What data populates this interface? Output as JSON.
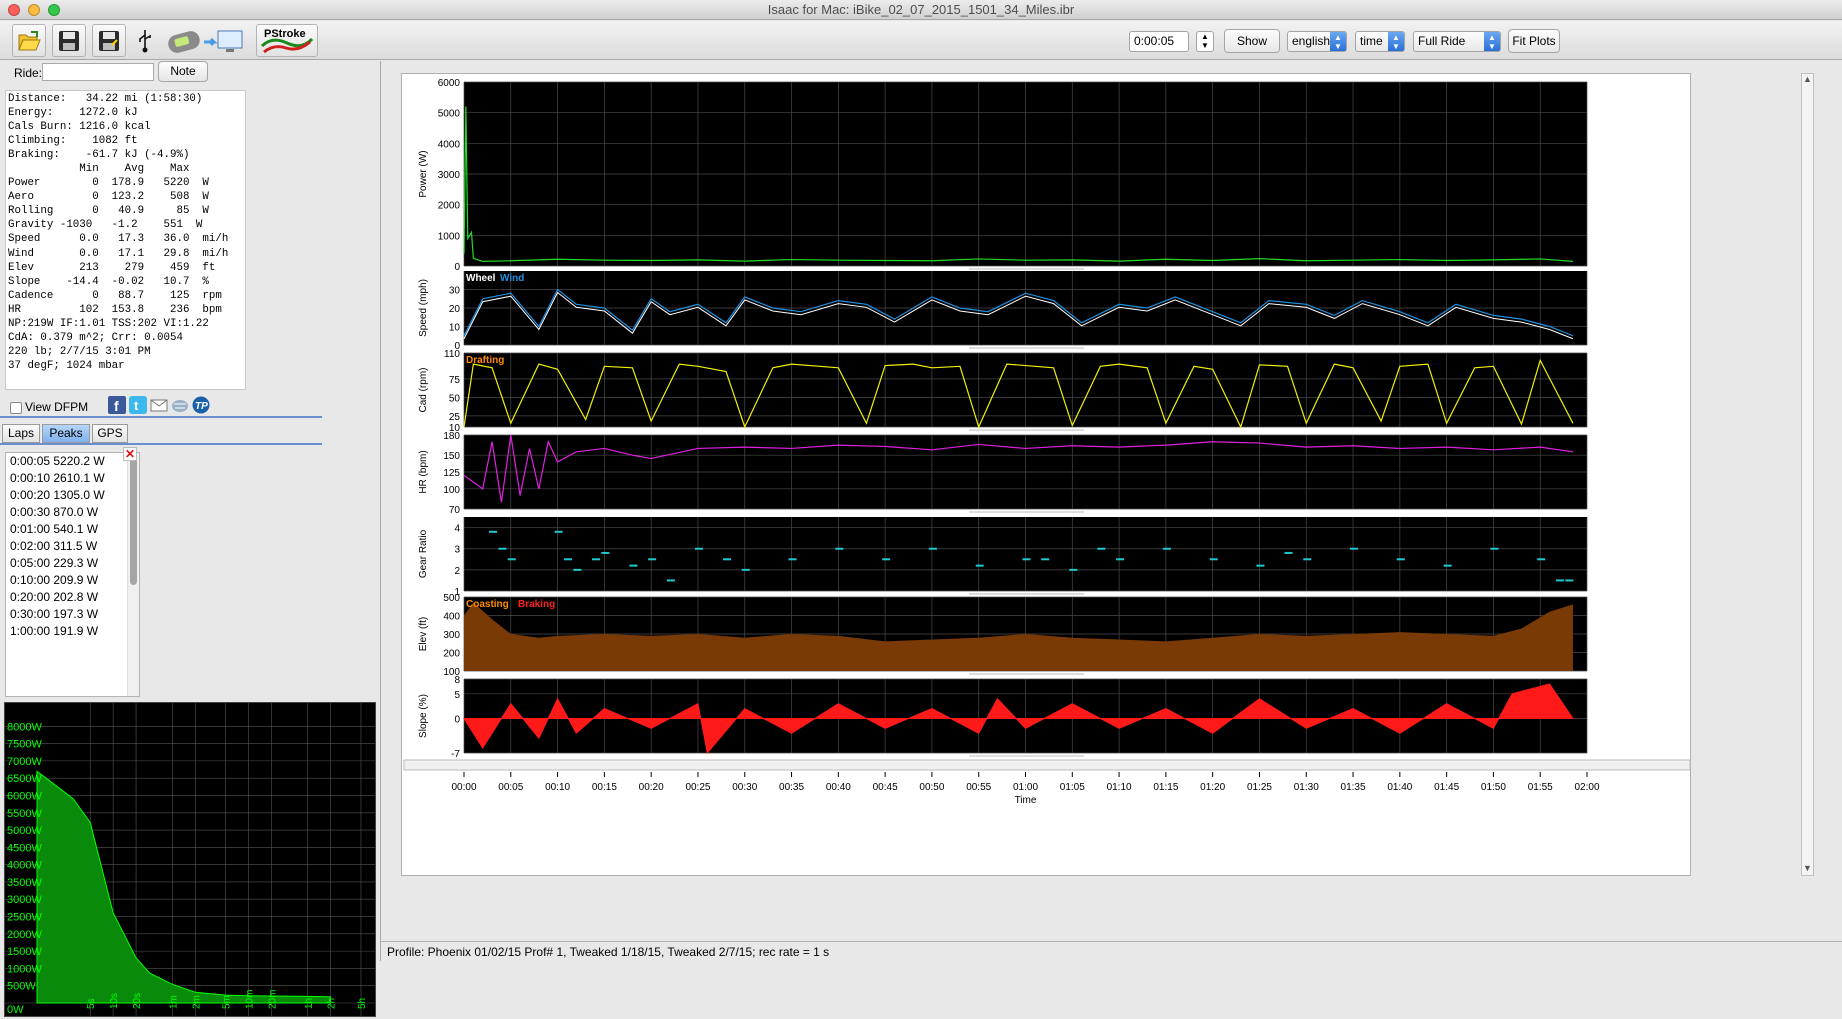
{
  "window": {
    "title": "Isaac for Mac:  iBike_02_07_2015_1501_34_Miles.ibr"
  },
  "toolbar": {
    "open_icon": "folder-open-icon",
    "save_icon": "floppy-save-icon",
    "saveas_icon": "floppy-save-as-icon",
    "usb_icon": "usb-icon",
    "sync_icon": "device-to-computer-icon",
    "pstroke_label": "PStroke",
    "time_value": "0:00:05",
    "show_label": "Show",
    "units": "english",
    "xaxis": "time",
    "range": "Full Ride",
    "fit_label": "Fit Plots"
  },
  "ride": {
    "label": "Ride:",
    "value": "",
    "note_label": "Note"
  },
  "summary": {
    "lines": [
      "Distance:   34.22 mi (1:58:30)",
      "Energy:    1272.0 kJ",
      "Cals Burn: 1216.0 kcal",
      "Climbing:    1082 ft",
      "Braking:    -61.7 kJ (-4.9%)",
      "           Min    Avg    Max",
      "Power        0  178.9   5220  W",
      "Aero         0  123.2    508  W",
      "Rolling      0   40.9     85  W",
      "Gravity -1030   -1.2    551  W",
      "Speed      0.0   17.3   36.0  mi/h",
      "Wind       0.0   17.1   29.8  mi/h",
      "Elev       213    279    459  ft",
      "Slope    -14.4  -0.02   10.7  %",
      "Cadence      0   88.7    125  rpm",
      "HR         102  153.8    236  bpm",
      "NP:219W IF:1.01 TSS:202 VI:1.22",
      "CdA: 0.379 m^2; Crr: 0.0054",
      "220 lb; 2/7/15 3:01 PM",
      "37 degF; 1024 mbar"
    ]
  },
  "dfpm": {
    "label": "View DFPM",
    "checked": false
  },
  "share_icons": [
    "facebook-icon",
    "twitter-icon",
    "email-icon",
    "cloud-upload-icon",
    "trainingpeaks-icon"
  ],
  "tabs": [
    {
      "label": "Laps",
      "active": false
    },
    {
      "label": "Peaks",
      "active": true
    },
    {
      "label": "GPS",
      "active": false
    }
  ],
  "peaks": [
    {
      "dur": "0:00:05",
      "val": "5220.2 W"
    },
    {
      "dur": "0:00:10",
      "val": "2610.1 W"
    },
    {
      "dur": "0:00:20",
      "val": "1305.0 W"
    },
    {
      "dur": "0:00:30",
      "val": "870.0 W"
    },
    {
      "dur": "0:01:00",
      "val": "540.1 W"
    },
    {
      "dur": "0:02:00",
      "val": "311.5 W"
    },
    {
      "dur": "0:05:00",
      "val": "229.3 W"
    },
    {
      "dur": "0:10:00",
      "val": "209.9 W"
    },
    {
      "dur": "0:20:00",
      "val": "202.8 W"
    },
    {
      "dur": "0:30:00",
      "val": "197.3 W"
    },
    {
      "dur": "1:00:00",
      "val": "191.9 W"
    }
  ],
  "chart_data": [
    {
      "type": "area",
      "name": "peak-power-curve",
      "y_ticks": [
        "0W",
        "500W",
        "1000W",
        "1500W",
        "2000W",
        "2500W",
        "3000W",
        "3500W",
        "4000W",
        "4500W",
        "5000W",
        "5500W",
        "6000W",
        "6500W",
        "7000W",
        "7500W",
        "8000W"
      ],
      "x_ticks": [
        "5s",
        "10s",
        "20s",
        "1m",
        "2m",
        "5m",
        "10m",
        "20m",
        "1h",
        "2h",
        "5h"
      ],
      "points_sec": [
        1,
        2,
        3,
        5,
        10,
        20,
        30,
        60,
        120,
        300,
        600,
        1200,
        1800,
        3600,
        7110
      ],
      "points_w": [
        6700,
        6200,
        5900,
        5220,
        2610,
        1305,
        870,
        540,
        311,
        229,
        210,
        203,
        197,
        192,
        180
      ],
      "ylim": [
        0,
        8500
      ],
      "color": "#00ff00"
    },
    {
      "type": "line",
      "name": "power",
      "ylabel": "Power (W)",
      "yticks": [
        "0",
        "1000",
        "2000",
        "3000",
        "4000",
        "5000",
        "6000"
      ],
      "ylim": [
        0,
        6000
      ],
      "color": "#22dd22",
      "x_min": [
        0,
        0.2,
        0.4,
        0.8,
        1,
        2,
        5,
        10,
        15,
        20,
        25,
        30,
        35,
        40,
        45,
        50,
        55,
        60,
        65,
        70,
        75,
        80,
        85,
        90,
        95,
        100,
        105,
        110,
        115,
        118.5
      ],
      "y": [
        400,
        5200,
        900,
        1100,
        250,
        150,
        170,
        220,
        190,
        180,
        200,
        160,
        210,
        190,
        180,
        170,
        230,
        190,
        200,
        160,
        220,
        180,
        240,
        170,
        190,
        210,
        180,
        200,
        230,
        150
      ]
    },
    {
      "type": "line",
      "name": "speed",
      "ylabel": "Speed (mph)",
      "legend": [
        "Wheel",
        "Wind"
      ],
      "yticks": [
        "0",
        "10",
        "20",
        "30"
      ],
      "ylim": [
        0,
        40
      ],
      "colors": [
        "#ffffff",
        "#1e90e0"
      ],
      "x_min": [
        0,
        2,
        5,
        8,
        10,
        12,
        15,
        18,
        20,
        22,
        25,
        28,
        30,
        33,
        36,
        40,
        43,
        46,
        50,
        53,
        56,
        60,
        63,
        66,
        70,
        73,
        76,
        80,
        83,
        86,
        90,
        93,
        96,
        100,
        103,
        106,
        110,
        113,
        116,
        118.5
      ],
      "y": [
        5,
        25,
        28,
        10,
        30,
        22,
        20,
        8,
        25,
        18,
        22,
        12,
        26,
        20,
        18,
        24,
        22,
        14,
        26,
        20,
        18,
        28,
        24,
        12,
        22,
        20,
        26,
        18,
        12,
        24,
        22,
        16,
        24,
        18,
        12,
        22,
        16,
        14,
        10,
        5
      ]
    },
    {
      "type": "line",
      "name": "cadence",
      "ylabel": "Cad (rpm)",
      "legend": [
        "Drafting"
      ],
      "yticks": [
        "10",
        "25",
        "50",
        "75",
        "110"
      ],
      "ylim": [
        10,
        110
      ],
      "color": "#f0f000",
      "x_min": [
        0,
        1,
        3,
        5,
        8,
        10,
        13,
        15,
        18,
        20,
        23,
        25,
        28,
        30,
        33,
        35,
        38,
        40,
        43,
        45,
        48,
        50,
        53,
        55,
        58,
        60,
        63,
        65,
        68,
        70,
        73,
        75,
        78,
        80,
        83,
        85,
        88,
        90,
        93,
        95,
        98,
        100,
        103,
        105,
        108,
        110,
        113,
        115,
        118.5
      ],
      "y": [
        10,
        95,
        90,
        15,
        95,
        88,
        20,
        92,
        90,
        18,
        95,
        92,
        85,
        10,
        90,
        95,
        92,
        90,
        15,
        93,
        95,
        90,
        92,
        10,
        95,
        93,
        90,
        12,
        92,
        95,
        90,
        15,
        92,
        88,
        10,
        94,
        92,
        15,
        95,
        90,
        18,
        92,
        95,
        15,
        90,
        92,
        14,
        100,
        15
      ]
    },
    {
      "type": "line",
      "name": "heart-rate",
      "ylabel": "HR (bpm)",
      "yticks": [
        "70",
        "100",
        "125",
        "150",
        "180"
      ],
      "ylim": [
        70,
        180
      ],
      "color": "#e020e0",
      "x_min": [
        0,
        2,
        3,
        4,
        5,
        6,
        7,
        8,
        9,
        10,
        12,
        15,
        18,
        20,
        25,
        30,
        35,
        40,
        45,
        50,
        55,
        60,
        65,
        70,
        75,
        80,
        85,
        90,
        95,
        100,
        105,
        110,
        115,
        118.5
      ],
      "y": [
        120,
        100,
        170,
        80,
        180,
        90,
        160,
        100,
        170,
        140,
        155,
        160,
        150,
        145,
        160,
        162,
        160,
        165,
        163,
        158,
        166,
        160,
        164,
        162,
        165,
        170,
        168,
        162,
        164,
        160,
        162,
        158,
        162,
        155
      ]
    },
    {
      "type": "scatter",
      "name": "gear-ratio",
      "ylabel": "Gear Ratio",
      "yticks": [
        "1",
        "2",
        "3",
        "4"
      ],
      "ylim": [
        1,
        4.5
      ],
      "color": "#20c8d0",
      "x_min": [
        3,
        4,
        5,
        10,
        11,
        12,
        14,
        15,
        18,
        20,
        22,
        25,
        28,
        30,
        35,
        40,
        45,
        50,
        55,
        60,
        62,
        65,
        68,
        70,
        75,
        80,
        85,
        88,
        90,
        95,
        100,
        105,
        110,
        115,
        117,
        118
      ],
      "y": [
        3.8,
        3,
        2.5,
        3.8,
        2.5,
        2,
        2.5,
        2.8,
        2.2,
        2.5,
        1.5,
        3,
        2.5,
        2,
        2.5,
        3,
        2.5,
        3,
        2.2,
        2.5,
        2.5,
        2,
        3,
        2.5,
        3,
        2.5,
        2.2,
        2.8,
        2.5,
        3,
        2.5,
        2.2,
        3,
        2.5,
        1.5,
        1.5
      ]
    },
    {
      "type": "area",
      "name": "elevation",
      "ylabel": "Elev (ft)",
      "legend": [
        "Coasting",
        "Braking"
      ],
      "yticks": [
        "100",
        "200",
        "300",
        "400",
        "500"
      ],
      "ylim": [
        100,
        500
      ],
      "colors": [
        "#7a3a05",
        "#ff7000",
        "#ff2020"
      ],
      "x_min": [
        0,
        1,
        3,
        5,
        8,
        10,
        15,
        20,
        25,
        30,
        35,
        40,
        45,
        50,
        55,
        60,
        65,
        70,
        75,
        80,
        85,
        90,
        95,
        100,
        105,
        110,
        113,
        116,
        118.5
      ],
      "y": [
        400,
        470,
        380,
        300,
        280,
        290,
        300,
        290,
        300,
        280,
        300,
        290,
        260,
        270,
        280,
        300,
        280,
        270,
        260,
        280,
        300,
        290,
        300,
        310,
        300,
        290,
        330,
        420,
        460
      ]
    },
    {
      "type": "area",
      "name": "slope",
      "ylabel": "Slope (%)",
      "yticks": [
        "-7",
        "0",
        "5",
        "8"
      ],
      "ylim": [
        -7,
        8
      ],
      "color": "#ff1a1a",
      "x_min": [
        0,
        2,
        5,
        8,
        10,
        12,
        15,
        20,
        25,
        26,
        30,
        35,
        40,
        45,
        50,
        55,
        57,
        60,
        65,
        70,
        75,
        80,
        85,
        90,
        95,
        100,
        105,
        110,
        112,
        114,
        116,
        118.5
      ],
      "y": [
        0,
        -6,
        3,
        -4,
        4,
        -3,
        2,
        -2,
        3,
        -7,
        2,
        -3,
        3,
        -2,
        2,
        -3,
        4,
        -2,
        3,
        -2,
        2,
        -3,
        4,
        -2,
        2,
        -3,
        3,
        -2,
        5,
        6,
        7,
        0
      ]
    }
  ],
  "x_axis": {
    "label": "Time",
    "ticks": [
      "00:00",
      "00:05",
      "00:10",
      "00:15",
      "00:20",
      "00:25",
      "00:30",
      "00:35",
      "00:40",
      "00:45",
      "00:50",
      "00:55",
      "01:00",
      "01:05",
      "01:10",
      "01:15",
      "01:20",
      "01:25",
      "01:30",
      "01:35",
      "01:40",
      "01:45",
      "01:50",
      "01:55",
      "02:00"
    ],
    "max_min": 120
  },
  "status": {
    "text": "Profile: Phoenix 01/02/15 Prof# 1, Tweaked 1/18/15, Tweaked 2/7/15; rec rate = 1 s"
  }
}
